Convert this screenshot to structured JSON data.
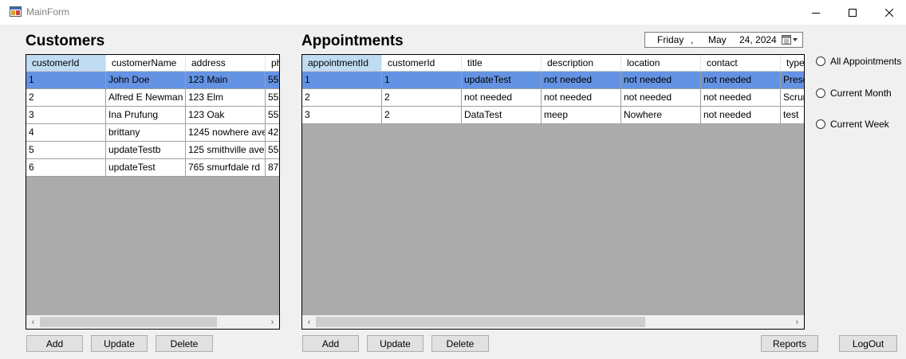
{
  "window": {
    "title": "MainForm"
  },
  "customers": {
    "title": "Customers",
    "columns": [
      "customerId",
      "customerName",
      "address",
      "ph"
    ],
    "rows": [
      [
        "1",
        "John Doe",
        "123 Main",
        "55"
      ],
      [
        "2",
        "Alfred E Newman",
        "123 Elm",
        "55"
      ],
      [
        "3",
        "Ina Prufung",
        "123 Oak",
        "55"
      ],
      [
        "4",
        "brittany",
        "1245 nowhere ave",
        "42"
      ],
      [
        "5",
        "updateTestb",
        "125 smithville ave",
        "55"
      ],
      [
        "6",
        "updateTest",
        "765 smurfdale rd",
        "87"
      ]
    ],
    "selected_row": 0,
    "buttons": {
      "add": "Add",
      "update": "Update",
      "delete": "Delete"
    }
  },
  "appointments": {
    "title": "Appointments",
    "columns": [
      "appointmentId",
      "customerId",
      "title",
      "description",
      "location",
      "contact",
      "type"
    ],
    "rows": [
      [
        "1",
        "1",
        "updateTest",
        "not needed",
        "not needed",
        "not needed",
        "Prese"
      ],
      [
        "2",
        "2",
        "not needed",
        "not needed",
        "not needed",
        "not needed",
        "Scrum"
      ],
      [
        "3",
        "2",
        "DataTest",
        "meep",
        "Nowhere",
        "not needed",
        "test"
      ]
    ],
    "selected_row": 0,
    "buttons": {
      "add": "Add",
      "update": "Update",
      "delete": "Delete"
    }
  },
  "date_picker": {
    "day": "Friday",
    "sep": ",",
    "month": "May",
    "date": "24, 2024"
  },
  "filters": {
    "all": "All Appointments",
    "month": "Current Month",
    "week": "Current Week",
    "selected": null
  },
  "actions": {
    "reports": "Reports",
    "logout": "LogOut"
  }
}
